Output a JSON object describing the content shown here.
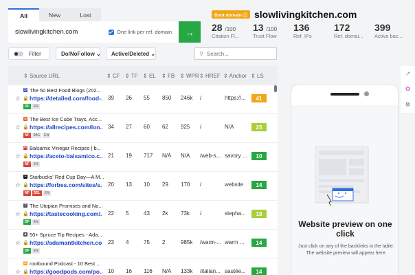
{
  "tabs": [
    {
      "label": "All",
      "active": true
    },
    {
      "label": "New",
      "active": false
    },
    {
      "label": "Lost",
      "active": false
    }
  ],
  "domain_input": {
    "value": "slowlivingkitchen.com"
  },
  "one_link_label": "One link per ref. domain",
  "go_icon": "arrow-right-icon",
  "boot_badge": "Boot domain",
  "site_name": "slowlivingkitchen.com",
  "stats": [
    {
      "value": "28",
      "suffix": "/100",
      "label": "Citation Fl..."
    },
    {
      "value": "13",
      "suffix": "/100",
      "label": "Trust Flow"
    },
    {
      "value": "136",
      "suffix": "",
      "label": "Ref. IPs"
    },
    {
      "value": "172",
      "suffix": "",
      "label": "Ref. domai..."
    },
    {
      "value": "399",
      "suffix": "",
      "label": "Active bac..."
    }
  ],
  "filters": {
    "filter_label": "Filter",
    "dofollow_label": "Do/NoFollow",
    "active_label": "Active/Deleted",
    "search_placeholder": "Search..."
  },
  "columns": [
    "Source URL",
    "CF",
    "TF",
    "EL",
    "FB",
    "WPR",
    "HREF",
    "Anchor",
    "LS"
  ],
  "rows": [
    {
      "title": "The 50 Best Food Blogs (202...",
      "url": "https://detailed.com/food-...",
      "tags": [
        "DF",
        "EN"
      ],
      "cf": "39",
      "tf": "26",
      "el": "55",
      "fb": "850",
      "wpr": "246k",
      "href": "/",
      "anchor": "https://...",
      "ls": "41",
      "ls_color": "#f2a615",
      "fav": "D",
      "fav_color": "#3a57c9"
    },
    {
      "title": "The Best Ice Cube Trays, Acc...",
      "url": "https://allrecipes.com/lon...",
      "tags": [
        "NF",
        "IMG",
        "EN"
      ],
      "cf": "34",
      "tf": "27",
      "el": "60",
      "fb": "62",
      "wpr": "925",
      "href": "/",
      "anchor": "N/A",
      "ls": "25",
      "ls_color": "#a8cf3a",
      "fav": "◎",
      "fav_color": "#e55a2b"
    },
    {
      "title": "Balsamic Vinegar Recipes | b...",
      "url": "https://aceto-balsamico.c...",
      "tags": [
        "NF",
        "EN"
      ],
      "cf": "21",
      "tf": "19",
      "el": "717",
      "fb": "N/A",
      "wpr": "N/A",
      "href": "/web-s...",
      "anchor": "savory ...",
      "ls": "10",
      "ls_color": "#27a844",
      "fav": "AB",
      "fav_color": "#c0392b"
    },
    {
      "title": "Starbucks' Red Cup Day—A M...",
      "url": "https://forbes.com/sites/s...",
      "tags": [
        "NF",
        "DEL",
        "EN"
      ],
      "cf": "20",
      "tf": "13",
      "el": "10",
      "fb": "29",
      "wpr": "170",
      "href": "/",
      "anchor": "website",
      "ls": "14",
      "ls_color": "#27a844",
      "fav": "F",
      "fav_color": "#111111"
    },
    {
      "title": "The Utopian Promises and No...",
      "url": "https://tastecooking.com/...",
      "tags": [
        "DF",
        "EN"
      ],
      "cf": "22",
      "tf": "5",
      "el": "43",
      "fb": "2k",
      "wpr": "73k",
      "href": "/",
      "anchor": "stepha...",
      "ls": "18",
      "ls_color": "#a8cf3a",
      "fav": "T",
      "fav_color": "#555555"
    },
    {
      "title": "50+ Spruce Tip Recipes - Ada...",
      "url": "https://adamantkitchen.co...",
      "tags": [
        "DF",
        "EN"
      ],
      "cf": "23",
      "tf": "4",
      "el": "75",
      "fb": "2",
      "wpr": "985k",
      "href": "/warm-...",
      "anchor": "warm ...",
      "ls": "14",
      "ls_color": "#27a844",
      "fav": "◈",
      "fav_color": "#444444"
    },
    {
      "title": "rootbound Podcast - 10 Best ...",
      "url": "https://goodpods.com/po...",
      "tags": [
        "DF",
        "EN"
      ],
      "cf": "10",
      "tf": "16",
      "el": "116",
      "fb": "N/A",
      "wpr": "133k",
      "href": "/italian...",
      "anchor": "sautée...",
      "ls": "14",
      "ls_color": "#27a844",
      "fav": "G",
      "fav_color": "#f2a615"
    }
  ],
  "side_icons": [
    "external-link-icon",
    "brain-icon",
    "eye-off-icon"
  ],
  "preview": {
    "title": "Website preview on one click",
    "desc_line1": "Just click on any of the backlinks in the table.",
    "desc_line2": "The website preview will appear here."
  }
}
